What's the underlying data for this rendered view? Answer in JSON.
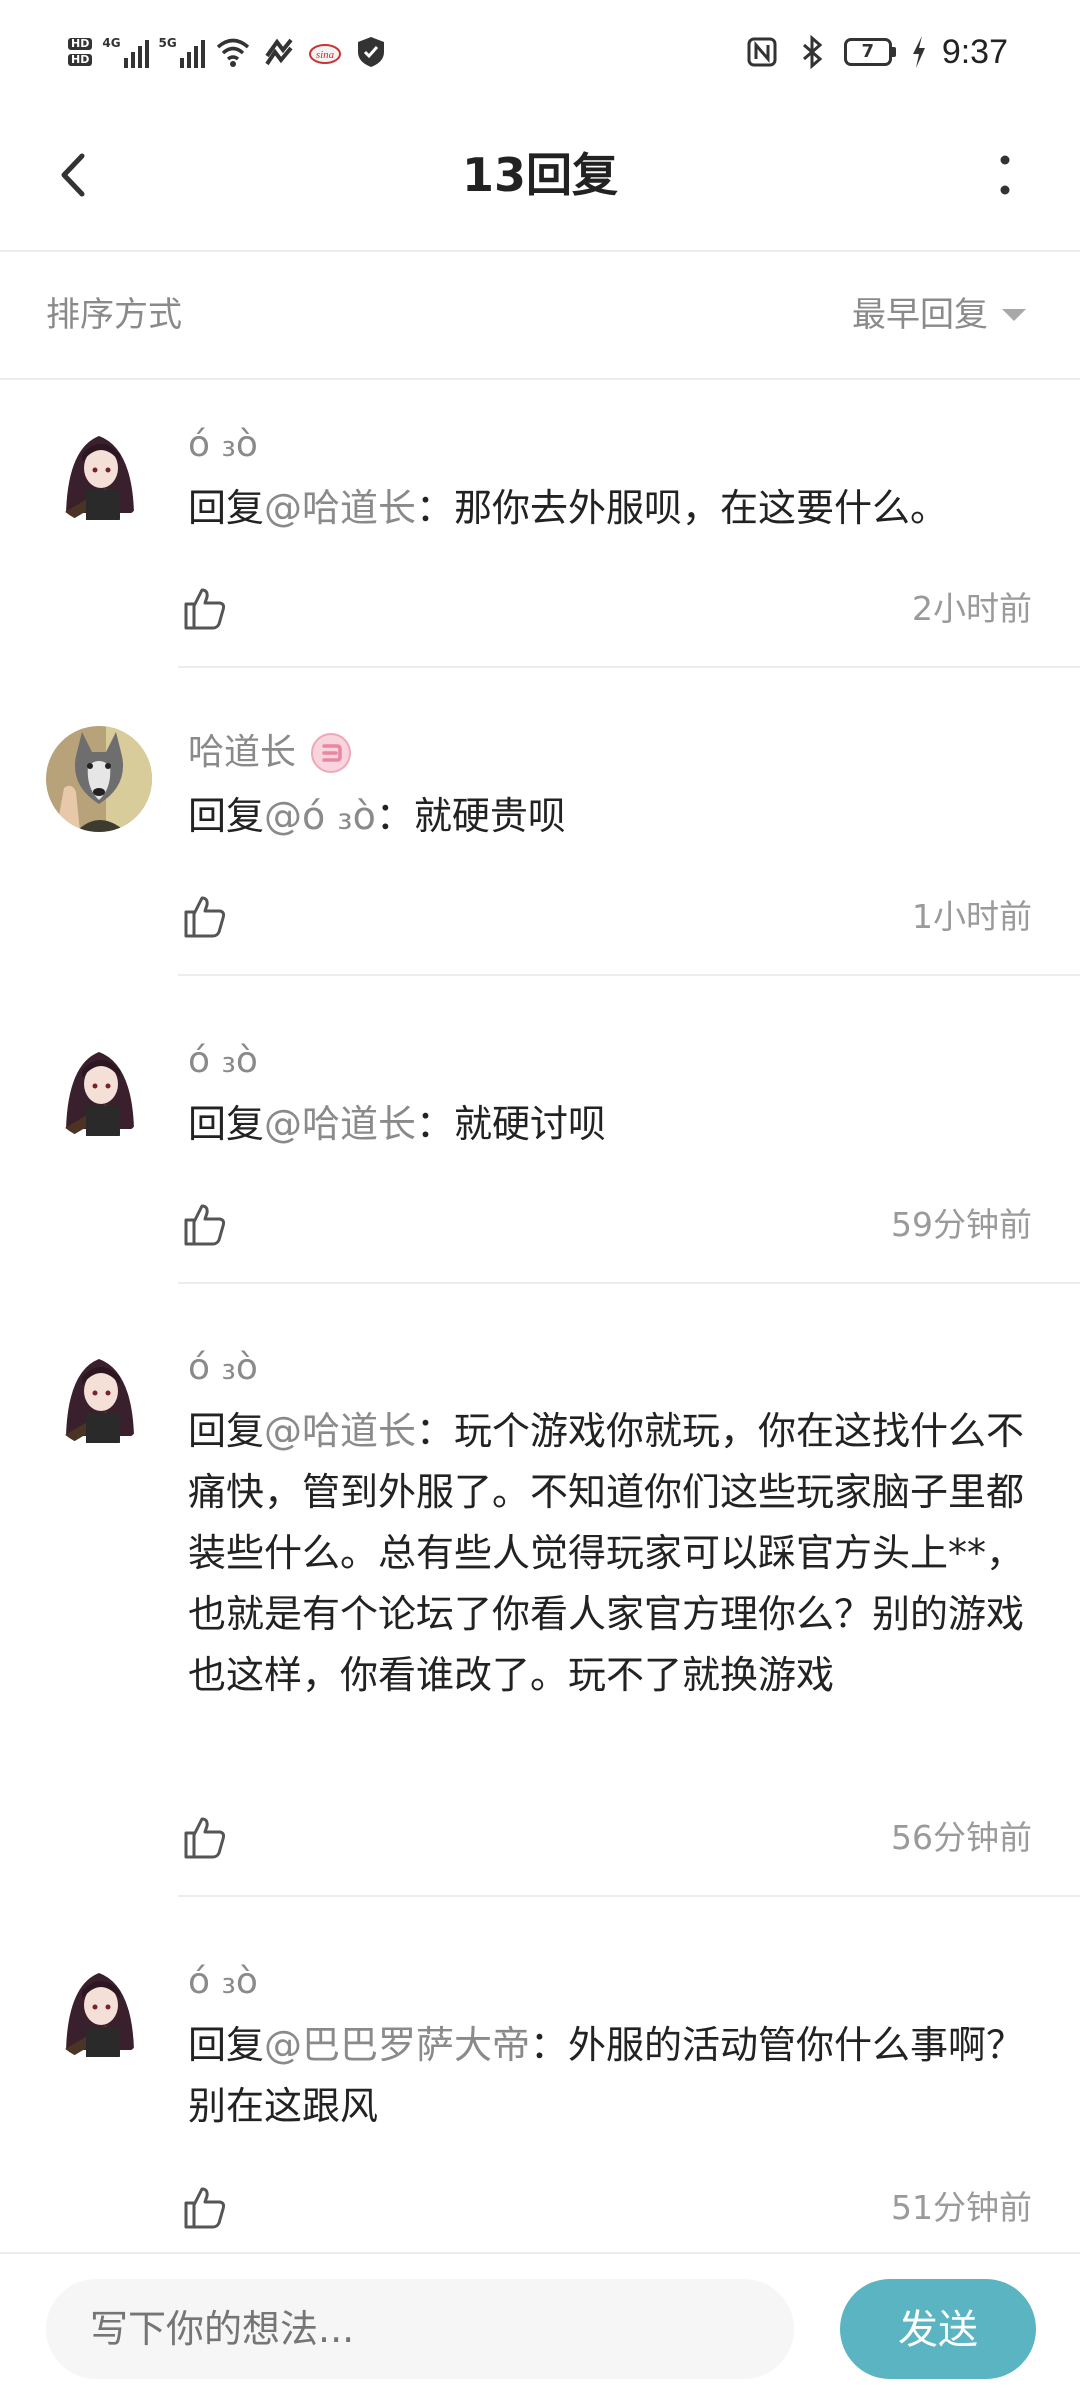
{
  "status_bar": {
    "network_left": "4G",
    "network_right": "5G",
    "hd_top": "HD",
    "hd_bottom": "HD",
    "battery_level": "7",
    "time": "9:37",
    "icons": [
      "hd-icon",
      "signal-4g-icon",
      "signal-5g-icon",
      "wifi-icon",
      "health-icon",
      "sina-icon",
      "shield-icon",
      "nfc-icon",
      "bluetooth-icon",
      "battery-icon",
      "charging-icon"
    ]
  },
  "header": {
    "title": "13回复",
    "back_icon": "chevron-left-icon",
    "more_icon": "more-vertical-icon"
  },
  "sort": {
    "label": "排序方式",
    "value": "最早回复"
  },
  "comments": [
    {
      "user": "ó ₃ò",
      "avatar": "anime-girl-avatar",
      "prefix": "回复",
      "mention": "@哈道长",
      "text": "：那你去外服呗，在这要什么。",
      "time": "2小时前"
    },
    {
      "user": "哈道长",
      "avatar": "dog-avatar",
      "badge": "level-badge-icon",
      "prefix": "回复",
      "mention": "@ó ₃ò",
      "text": "：就硬贵呗",
      "time": "1小时前"
    },
    {
      "user": "ó ₃ò",
      "avatar": "anime-girl-avatar",
      "prefix": "回复",
      "mention": "@哈道长",
      "text": "：就硬讨呗",
      "time": "59分钟前"
    },
    {
      "user": "ó ₃ò",
      "avatar": "anime-girl-avatar",
      "prefix": "回复",
      "mention": "@哈道长",
      "text": "：玩个游戏你就玩，你在这找什么不痛快，管到外服了。不知道你们这些玩家脑子里都装些什么。总有些人觉得玩家可以踩官方头上**，也就是有个论坛了你看人家官方理你么？别的游戏也这样，你看谁改了。玩不了就换游戏",
      "time": "56分钟前"
    },
    {
      "user": "ó ₃ò",
      "avatar": "anime-girl-avatar",
      "prefix": "回复",
      "mention": "@巴巴罗萨大帝",
      "text": "：外服的活动管你什么事啊？别在这跟风",
      "time": "51分钟前"
    }
  ],
  "bottom": {
    "input_placeholder": "写下你的想法...",
    "send_label": "发送"
  },
  "colors": {
    "accent": "#5ab4c2",
    "muted_text": "#8a8a8a",
    "divider": "#ededed"
  }
}
